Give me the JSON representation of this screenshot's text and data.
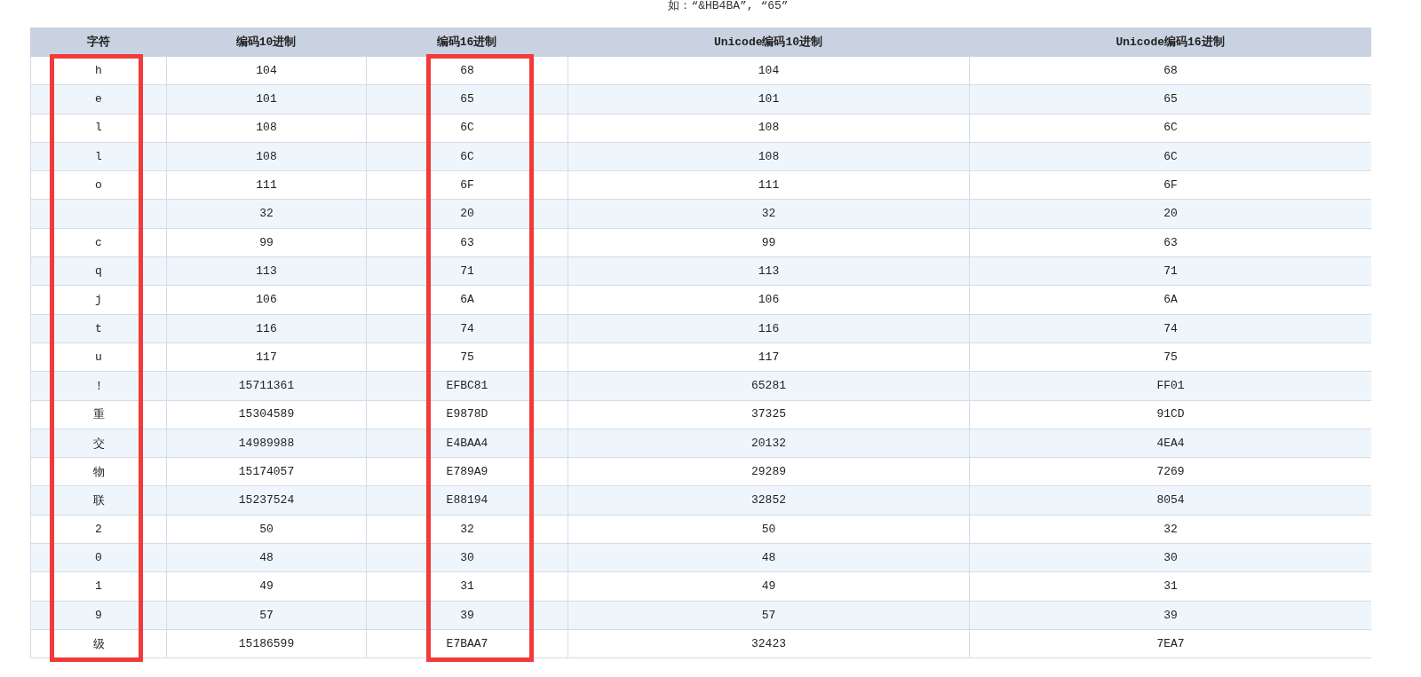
{
  "example_text": "如：“&HB4BA”, “65”",
  "columns": [
    {
      "label": "字符",
      "annotation": {
        "kind": "frame"
      }
    },
    {
      "label": "编码10进制"
    },
    {
      "label": "编码16进制",
      "annotation": {
        "kind": "frame"
      }
    },
    {
      "label": "Unicode编码10进制"
    },
    {
      "label": "Unicode编码16进制"
    }
  ],
  "rows": [
    {
      "cells": [
        "h",
        "104",
        "68",
        "104",
        "68"
      ]
    },
    {
      "cells": [
        "e",
        "101",
        "65",
        "101",
        "65"
      ]
    },
    {
      "cells": [
        "l",
        "108",
        "6C",
        "108",
        "6C"
      ]
    },
    {
      "cells": [
        "l",
        "108",
        "6C",
        "108",
        "6C"
      ]
    },
    {
      "cells": [
        "o",
        "111",
        "6F",
        "111",
        "6F"
      ]
    },
    {
      "cells": [
        null,
        "32",
        "20",
        "32",
        "20"
      ]
    },
    {
      "cells": [
        "c",
        "99",
        "63",
        "99",
        "63"
      ]
    },
    {
      "cells": [
        "q",
        "113",
        "71",
        "113",
        "71"
      ]
    },
    {
      "cells": [
        "j",
        "106",
        "6A",
        "106",
        "6A"
      ]
    },
    {
      "cells": [
        "t",
        "116",
        "74",
        "116",
        "74"
      ]
    },
    {
      "cells": [
        "u",
        "117",
        "75",
        "117",
        "75"
      ]
    },
    {
      "cells": [
        "！",
        "15711361",
        "EFBC81",
        "65281",
        "FF01"
      ]
    },
    {
      "cells": [
        "重",
        "15304589",
        "E9878D",
        "37325",
        "91CD"
      ]
    },
    {
      "cells": [
        "交",
        "14989988",
        "E4BAA4",
        "20132",
        "4EA4"
      ]
    },
    {
      "cells": [
        "物",
        "15174057",
        "E789A9",
        "29289",
        "7269"
      ]
    },
    {
      "cells": [
        "联",
        "15237524",
        "E88194",
        "32852",
        "8054"
      ]
    },
    {
      "cells": [
        "2",
        "50",
        "32",
        "50",
        "32"
      ]
    },
    {
      "cells": [
        "0",
        "48",
        "30",
        "48",
        "30"
      ]
    },
    {
      "cells": [
        "1",
        "49",
        "31",
        "49",
        "31"
      ]
    },
    {
      "cells": [
        "9",
        "57",
        "39",
        "57",
        "39"
      ]
    },
    {
      "cells": [
        "级",
        "15186599",
        "E7BAA7",
        "32423",
        "7EA7"
      ]
    }
  ]
}
